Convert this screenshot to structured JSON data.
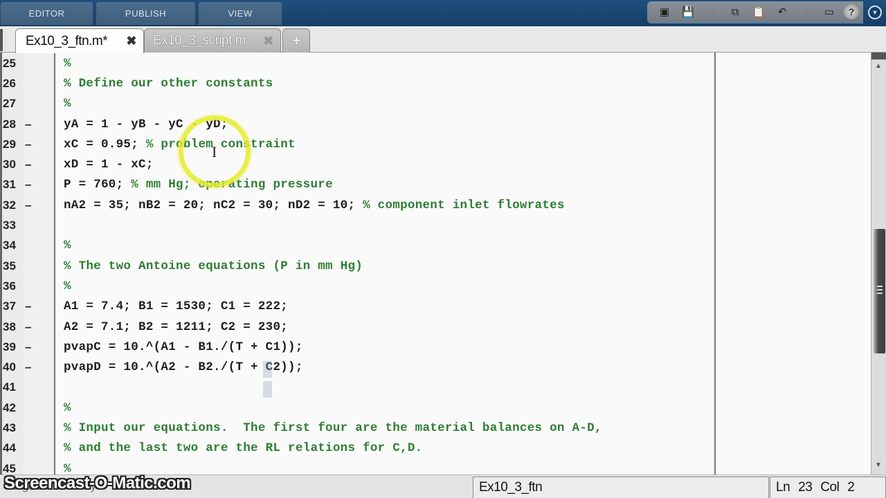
{
  "ribbon": {
    "tabs": [
      {
        "label": "EDITOR"
      },
      {
        "label": "PUBLISH"
      },
      {
        "label": "VIEW"
      }
    ],
    "quick_access": [
      {
        "icon": "new-script-icon",
        "glyph": "▣"
      },
      {
        "icon": "save-icon",
        "glyph": "💾"
      },
      {
        "icon": "cut-icon",
        "glyph": "✂"
      },
      {
        "icon": "copy-icon",
        "glyph": "⧉"
      },
      {
        "icon": "paste-icon",
        "glyph": "📋"
      },
      {
        "icon": "undo-icon",
        "glyph": "↶"
      },
      {
        "icon": "redo-icon",
        "glyph": "↷"
      },
      {
        "icon": "switch-windows-icon",
        "glyph": "▭"
      },
      {
        "icon": "help-icon",
        "glyph": "?"
      }
    ],
    "collapse_glyph": "▼"
  },
  "document_tabs": [
    {
      "label": "Ex10_3_ftn.m*",
      "active": true,
      "close_glyph": "✖"
    },
    {
      "label": "Ex10_3_script.m",
      "active": false,
      "close_glyph": "✖"
    }
  ],
  "new_tab_glyph": "+",
  "editor": {
    "lines": [
      {
        "n": "25",
        "marker": "",
        "code": "",
        "comment": "%"
      },
      {
        "n": "26",
        "marker": "",
        "code": "",
        "comment": "% Define our other constants"
      },
      {
        "n": "27",
        "marker": "",
        "code": "",
        "comment": "%"
      },
      {
        "n": "28",
        "marker": "–",
        "code": "yA = 1 - yB - yC - yD;",
        "comment": ""
      },
      {
        "n": "29",
        "marker": "–",
        "code": "xC = 0.95; ",
        "comment": "% problem constraint"
      },
      {
        "n": "30",
        "marker": "–",
        "code": "xD = 1 - xC;",
        "comment": ""
      },
      {
        "n": "31",
        "marker": "–",
        "code": "P = 760; ",
        "comment": "% mm Hg; operating pressure"
      },
      {
        "n": "32",
        "marker": "–",
        "code": "nA2 = 35; nB2 = 20; nC2 = 30; nD2 = 10; ",
        "comment": "% component inlet flowrates"
      },
      {
        "n": "33",
        "marker": "",
        "code": "",
        "comment": ""
      },
      {
        "n": "34",
        "marker": "",
        "code": "",
        "comment": "%"
      },
      {
        "n": "35",
        "marker": "",
        "code": "",
        "comment": "% The two Antoine equations (P in mm Hg)"
      },
      {
        "n": "36",
        "marker": "",
        "code": "",
        "comment": "%"
      },
      {
        "n": "37",
        "marker": "–",
        "code": "A1 = 7.4; B1 = 1530; C1 = 222;",
        "comment": ""
      },
      {
        "n": "38",
        "marker": "–",
        "code": "A2 = 7.1; B2 = 1211; C2 = 230;",
        "comment": ""
      },
      {
        "n": "39",
        "marker": "–",
        "code": "pvapC = 10.^(A1 - B1./(T + C1));",
        "comment": ""
      },
      {
        "n": "40",
        "marker": "–",
        "code": "pvapD = 10.^(A2 - B2./(T + C2));",
        "comment": ""
      },
      {
        "n": "41",
        "marker": "",
        "code": "",
        "comment": ""
      },
      {
        "n": "42",
        "marker": "",
        "code": "",
        "comment": "%"
      },
      {
        "n": "43",
        "marker": "",
        "code": "",
        "comment": "% Input our equations.  The first four are the material balances on A-D,"
      },
      {
        "n": "44",
        "marker": "",
        "code": "",
        "comment": "% and the last two are the RL relations for C,D."
      },
      {
        "n": "45",
        "marker": "",
        "code": "",
        "comment": "%"
      }
    ]
  },
  "colors": {
    "comment": "#2e7d32",
    "ribbon": "#1f4f7e",
    "cursor_highlight": "#e6eb28"
  },
  "statusbar": {
    "left_text": "Stage 1 of 1 ready",
    "watermark": "Screencast-O-Matic.com",
    "file": "Ex10_3_ftn",
    "ln_label": "Ln",
    "ln_value": "23",
    "col_label": "Col",
    "col_value": "2"
  }
}
